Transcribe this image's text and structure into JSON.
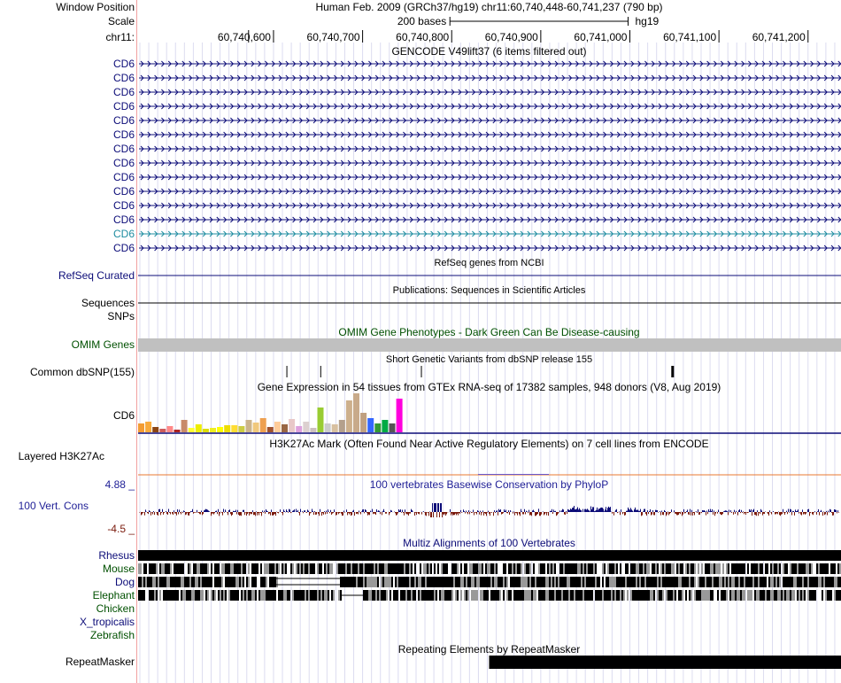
{
  "header": {
    "window_position_label": "Window Position",
    "window_position_value": "Human Feb. 2009 (GRCh37/hg19)   chr11:60,740,448-60,741,237 (790 bp)",
    "scale_label": "Scale",
    "scale_bar_text": "200 bases",
    "scale_assembly": "hg19",
    "chrom_label": "chr11:",
    "ruler_ticks": [
      {
        "label": "60,740,600",
        "pos": 60740600
      },
      {
        "label": "60,740,700",
        "pos": 60740700
      },
      {
        "label": "60,740,800",
        "pos": 60740800
      },
      {
        "label": "60,740,900",
        "pos": 60740900
      },
      {
        "label": "60,741,000",
        "pos": 60741000
      },
      {
        "label": "60,741,100",
        "pos": 60741100
      },
      {
        "label": "60,741,200",
        "pos": 60741200
      }
    ]
  },
  "colors": {
    "gene_blue": "#0c0c78",
    "gene_highlight": "#1e8ca0",
    "omim_green": "#005000",
    "conservation_blue": "#1e1e96",
    "conservation_pos": "#0c0c78",
    "conservation_neg": "#7a1a0c",
    "grid": "#dcdcf0",
    "omim_bar": "#c0c0c0",
    "h3k27ac_line": "#e87830"
  },
  "gencode": {
    "title": "GENCODE V49lift37 (6 items filtered out)",
    "items": [
      {
        "name": "CD6",
        "highlight": false
      },
      {
        "name": "CD6",
        "highlight": false
      },
      {
        "name": "CD6",
        "highlight": false
      },
      {
        "name": "CD6",
        "highlight": false
      },
      {
        "name": "CD6",
        "highlight": false
      },
      {
        "name": "CD6",
        "highlight": false
      },
      {
        "name": "CD6",
        "highlight": false
      },
      {
        "name": "CD6",
        "highlight": false
      },
      {
        "name": "CD6",
        "highlight": false
      },
      {
        "name": "CD6",
        "highlight": false
      },
      {
        "name": "CD6",
        "highlight": false
      },
      {
        "name": "CD6",
        "highlight": false
      },
      {
        "name": "CD6",
        "highlight": true
      },
      {
        "name": "CD6",
        "highlight": false
      }
    ]
  },
  "refseq": {
    "title": "RefSeq genes from NCBI",
    "label": "RefSeq Curated"
  },
  "publications": {
    "title": "Publications: Sequences in Scientific Articles",
    "label_sequences": "Sequences",
    "label_snps": "SNPs"
  },
  "omim": {
    "title": "OMIM Gene Phenotypes - Dark Green Can Be Disease-causing",
    "label": "OMIM Genes"
  },
  "dbsnp": {
    "title": "Short Genetic Variants from dbSNP release 155",
    "label": "Common dbSNP(155)",
    "variants": [
      60740615,
      60740653,
      60740766,
      60741048
    ]
  },
  "gtex": {
    "title": "Gene Expression in 54 tissues from GTEx RNA-seq of 17382 samples, 948 donors (V8, Aug 2019)",
    "label": "CD6",
    "bars": [
      {
        "v": 10,
        "c": "#f39c33"
      },
      {
        "v": 12,
        "c": "#f8aa3b"
      },
      {
        "v": 6,
        "c": "#8b4513"
      },
      {
        "v": 4,
        "c": "#cd5c5c"
      },
      {
        "v": 7,
        "c": "#ff8888"
      },
      {
        "v": 3,
        "c": "#aa2222"
      },
      {
        "v": 14,
        "c": "#c88a6a"
      },
      {
        "v": 5,
        "c": "#ffff33"
      },
      {
        "v": 9,
        "c": "#eeee00"
      },
      {
        "v": 4,
        "c": "#dddd00"
      },
      {
        "v": 5,
        "c": "#eeee22"
      },
      {
        "v": 6,
        "c": "#ffff00"
      },
      {
        "v": 8,
        "c": "#eedd00"
      },
      {
        "v": 8,
        "c": "#ffdd33"
      },
      {
        "v": 7,
        "c": "#cccc44"
      },
      {
        "v": 14,
        "c": "#ccb48c"
      },
      {
        "v": 11,
        "c": "#f0c87c"
      },
      {
        "v": 16,
        "c": "#eea050"
      },
      {
        "v": 6,
        "c": "#a0522d"
      },
      {
        "v": 12,
        "c": "#ffcc99"
      },
      {
        "v": 9,
        "c": "#996644"
      },
      {
        "v": 15,
        "c": "#e8c8c8"
      },
      {
        "v": 7,
        "c": "#dda0dd"
      },
      {
        "v": 12,
        "c": "#dcd0d0"
      },
      {
        "v": 5,
        "c": "#ccc0c0"
      },
      {
        "v": 28,
        "c": "#99cc33"
      },
      {
        "v": 10,
        "c": "#cccccc"
      },
      {
        "v": 9,
        "c": "#d8c0a0"
      },
      {
        "v": 14,
        "c": "#b4a08c"
      },
      {
        "v": 36,
        "c": "#cdb08c"
      },
      {
        "v": 44,
        "c": "#c8aa8a"
      },
      {
        "v": 22,
        "c": "#c0a080"
      },
      {
        "v": 16,
        "c": "#3366ff"
      },
      {
        "v": 10,
        "c": "#339933"
      },
      {
        "v": 14,
        "c": "#00aa44"
      },
      {
        "v": 10,
        "c": "#555555"
      },
      {
        "v": 38,
        "c": "#ff00dd"
      }
    ]
  },
  "h3k27ac": {
    "title": "H3K27Ac Mark (Often Found Near Active Regulatory Elements) on 7 cell lines from ENCODE",
    "label": "Layered H3K27Ac"
  },
  "phylop": {
    "title": "100 vertebrates Basewise Conservation by PhyloP",
    "label": "100 Vert. Cons",
    "max_label": "4.88 _",
    "min_label": "-4.5 _",
    "range": [
      -4.5,
      4.88
    ]
  },
  "multiz": {
    "title": "Multiz Alignments of 100 Vertebrates",
    "species": [
      {
        "name": "Rhesus",
        "color": "#0c0c78"
      },
      {
        "name": "Mouse",
        "color": "#005000"
      },
      {
        "name": "Dog",
        "color": "#0c0c78"
      },
      {
        "name": "Elephant",
        "color": "#005000"
      },
      {
        "name": "Chicken",
        "color": "#005000"
      },
      {
        "name": "X_tropicalis",
        "color": "#0c0c78"
      },
      {
        "name": "Zebrafish",
        "color": "#005000"
      }
    ]
  },
  "repeatmasker": {
    "title": "Repeating Elements by RepeatMasker",
    "label": "RepeatMasker",
    "start": 60740842,
    "end": 60741237
  },
  "region": {
    "start": 60740448,
    "end": 60741237
  }
}
